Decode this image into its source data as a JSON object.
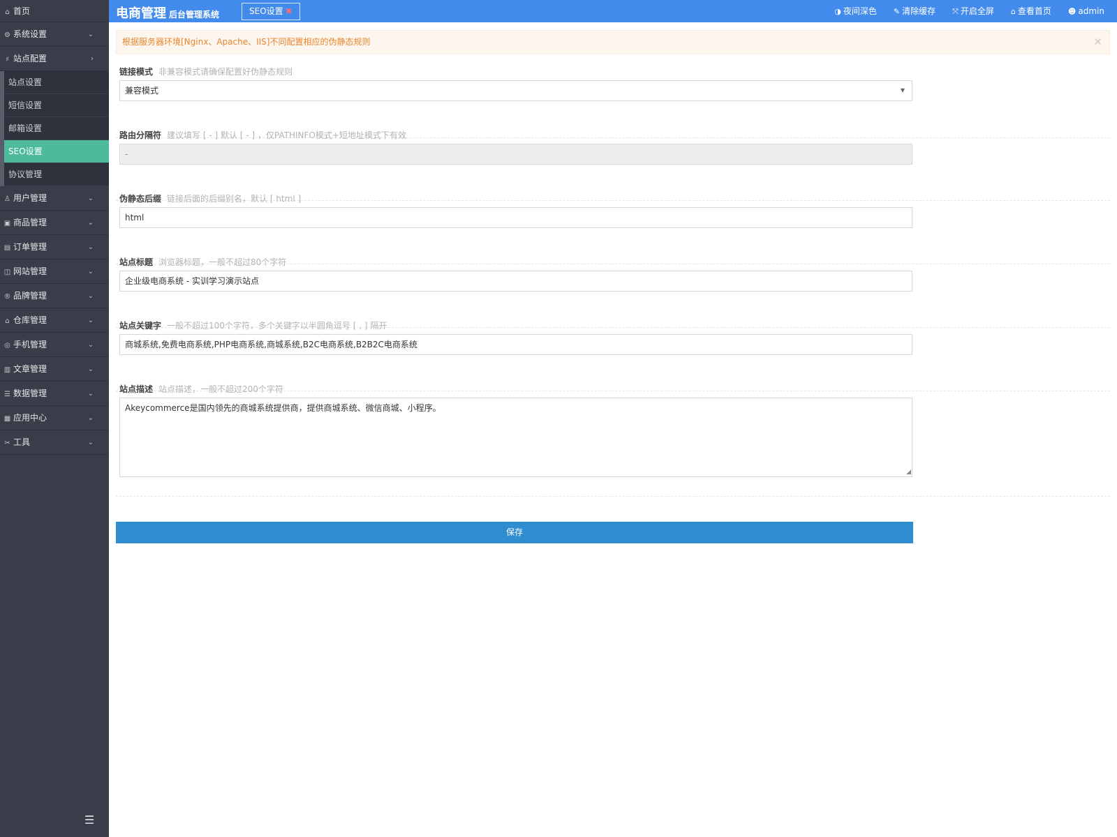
{
  "header": {
    "brand_main": "电商管理",
    "brand_sub": "后台管理系统",
    "tab_label": "SEO设置",
    "tab_close": "✖",
    "nav": [
      {
        "icon": "◑",
        "label": "夜间深色"
      },
      {
        "icon": "✎",
        "label": "清除缓存"
      },
      {
        "icon": "⤧",
        "label": "开启全屏"
      },
      {
        "icon": "⌂",
        "label": "查看首页"
      },
      {
        "icon": "☻",
        "label": "admin"
      }
    ]
  },
  "sidebar": {
    "home": {
      "icon": "⌂",
      "label": "首页"
    },
    "system": {
      "icon": "⚙",
      "label": "系统设置"
    },
    "site_config": {
      "icon": "♯",
      "label": "站点配置"
    },
    "sub_items": [
      "站点设置",
      "短信设置",
      "邮箱设置",
      "SEO设置",
      "协议管理"
    ],
    "items": [
      {
        "icon": "♙",
        "label": "用户管理"
      },
      {
        "icon": "▣",
        "label": "商品管理"
      },
      {
        "icon": "▤",
        "label": "订单管理"
      },
      {
        "icon": "◫",
        "label": "网站管理"
      },
      {
        "icon": "®",
        "label": "品牌管理"
      },
      {
        "icon": "⌂",
        "label": "仓库管理"
      },
      {
        "icon": "◎",
        "label": "手机管理"
      },
      {
        "icon": "▥",
        "label": "文章管理"
      },
      {
        "icon": "☰",
        "label": "数据管理"
      },
      {
        "icon": "▦",
        "label": "应用中心"
      },
      {
        "icon": "✂",
        "label": "工具"
      }
    ],
    "collapse_icon": "☰",
    "active_color": "#4dbb9b",
    "bg_color": "#393d49"
  },
  "alert": {
    "text": "根据服务器环境[Nginx、Apache、IIS]不同配置相应的伪静态规则",
    "close": "✕"
  },
  "form": {
    "link_mode": {
      "label": "链接模式",
      "hint": "非兼容模式请确保配置好伪静态规则",
      "value": "兼容模式",
      "caret": "▼"
    },
    "route_sep": {
      "label": "路由分隔符",
      "hint": "建议填写 [ - ] 默认 [ - ] ，仅PATHINFO模式+短地址模式下有效",
      "value": "-"
    },
    "suffix": {
      "label": "伪静态后缀",
      "hint": "链接后面的后缀别名，默认 [ html ]",
      "value": "html"
    },
    "site_title": {
      "label": "站点标题",
      "hint": "浏览器标题，一般不超过80个字符",
      "value": "企业级电商系统 - 实训学习演示站点"
    },
    "keywords": {
      "label": "站点关键字",
      "hint": "一般不超过100个字符，多个关键字以半圆角逗号 [ , ] 隔开",
      "value": "商城系统,免费电商系统,PHP电商系统,商城系统,B2C电商系统,B2B2C电商系统"
    },
    "description": {
      "label": "站点描述",
      "hint": "站点描述，一般不超过200个字符",
      "value": "Akeycommerce是国内领先的商城系统提供商，提供商城系统、微信商城、小程序。"
    },
    "save_label": "保存"
  },
  "colors": {
    "header": "#428bed",
    "save_button": "#2e8ecf",
    "alert_text": "#e8862f"
  }
}
